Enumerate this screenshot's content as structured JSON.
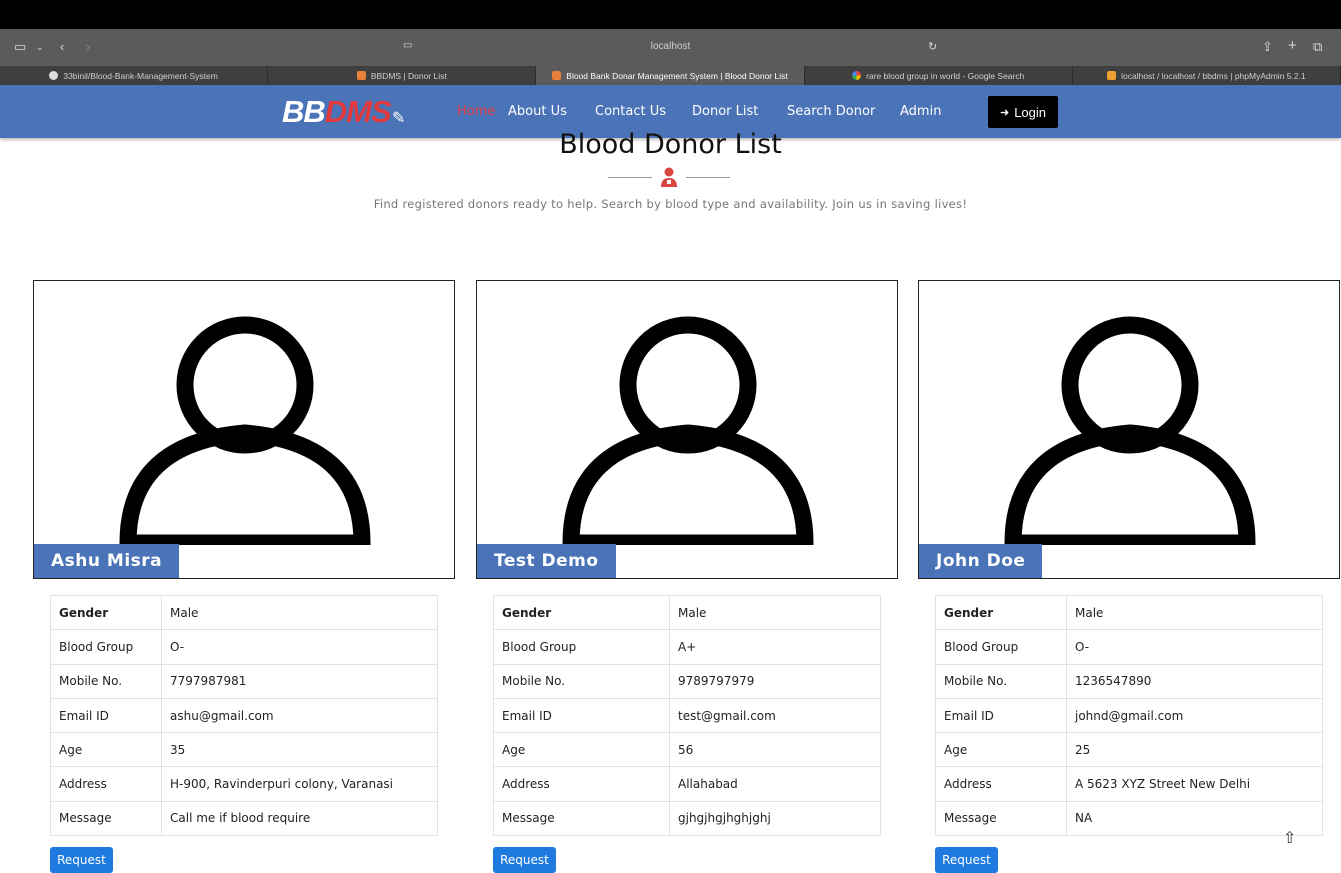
{
  "browser": {
    "url": "localhost",
    "tabs": [
      {
        "label": "33binil/Blood-Bank-Management-System",
        "active": false,
        "icon": "github-icon"
      },
      {
        "label": "BBDMS | Donor List",
        "active": false,
        "icon": "site-icon"
      },
      {
        "label": "Blood Bank Donar Management System | Blood Donor List",
        "active": true,
        "icon": "site-icon"
      },
      {
        "label": "rare blood group in world - Google Search",
        "active": false,
        "icon": "google-icon"
      },
      {
        "label": "localhost / localhost / bbdms | phpMyAdmin 5.2.1",
        "active": false,
        "icon": "phpmyadmin-icon"
      }
    ]
  },
  "navbar": {
    "brand_white": "BB",
    "brand_red": "DMS",
    "items": [
      "Home",
      "About Us",
      "Contact Us",
      "Donor List",
      "Search Donor",
      "Admin"
    ],
    "login_label": "Login"
  },
  "page": {
    "title": "Blood Donor List",
    "subtitle": "Find registered donors ready to help. Search by blood type and availability. Join us in saving lives!"
  },
  "field_labels": [
    "Gender",
    "Blood Group",
    "Mobile No.",
    "Email ID",
    "Age",
    "Address",
    "Message"
  ],
  "donors": [
    {
      "name": "Ashu Misra",
      "gender": "Male",
      "blood_group": "O-",
      "mobile": "7797987981",
      "email": "ashu@gmail.com",
      "age": "35",
      "address": "H-900, Ravinderpuri colony, Varanasi",
      "message": "Call me if blood require",
      "button": "Request"
    },
    {
      "name": "Test Demo",
      "gender": "Male",
      "blood_group": "A+",
      "mobile": "9789797979",
      "email": "test@gmail.com",
      "age": "56",
      "address": "Allahabad",
      "message": "gjhgjhgjhghjghj",
      "button": "Request"
    },
    {
      "name": "John Doe",
      "gender": "Male",
      "blood_group": "O-",
      "mobile": "1236547890",
      "email": "johnd@gmail.com",
      "age": "25",
      "address": "A 5623 XYZ Street New Delhi",
      "message": "NA",
      "button": "Request"
    }
  ],
  "colors": {
    "navbar": "#4a73b8",
    "brand_red": "#e0393e",
    "request_button": "#1f7ae0"
  }
}
